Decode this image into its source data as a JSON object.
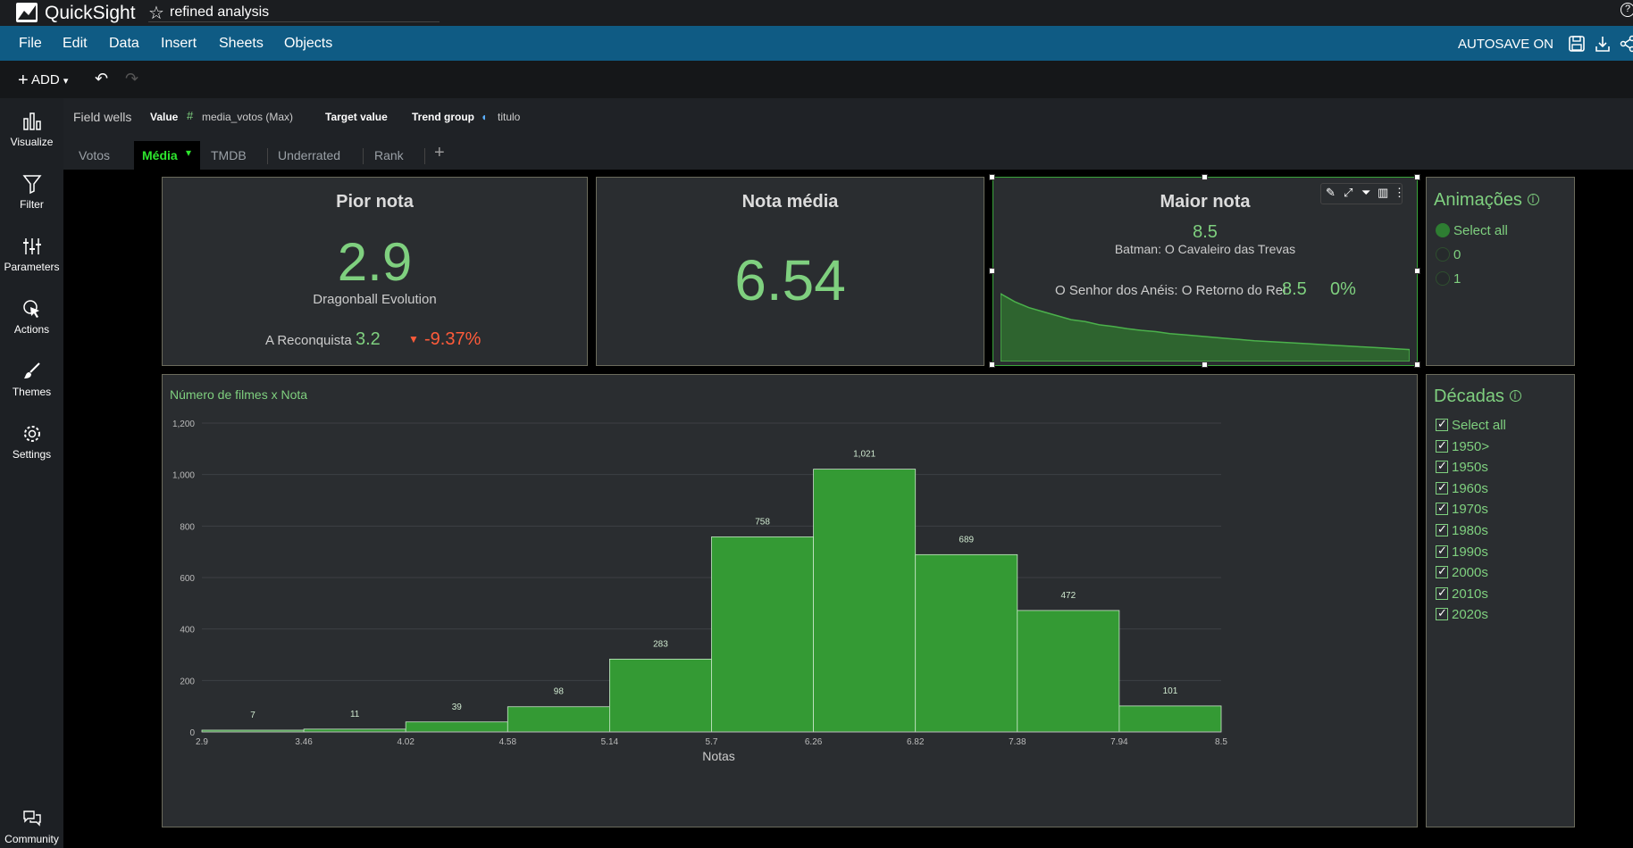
{
  "app": {
    "brand": "QuickSight",
    "analysis_title": "refined analysis"
  },
  "menu": {
    "items": [
      "File",
      "Edit",
      "Data",
      "Insert",
      "Sheets",
      "Objects"
    ],
    "autosave": "AUTOSAVE ON"
  },
  "toolbar": {
    "add_label": "ADD"
  },
  "rail": {
    "items": [
      "Visualize",
      "Filter",
      "Parameters",
      "Actions",
      "Themes",
      "Settings"
    ],
    "community": "Community"
  },
  "field_wells": {
    "title": "Field wells",
    "value_label": "Value",
    "value_field": "media_votos (Max)",
    "target_label": "Target value",
    "trend_label": "Trend group",
    "trend_field": "titulo"
  },
  "tabs": {
    "items": [
      "Votos",
      "Média",
      "TMDB",
      "Underrated",
      "Rank"
    ],
    "active": "Média",
    "add": "+"
  },
  "kpi_pior": {
    "title": "Pior nota",
    "value": "2.9",
    "subtitle": "Dragonball Evolution",
    "compare_label": "A Reconquista",
    "compare_value": "3.2",
    "delta": "-9.37%"
  },
  "kpi_media": {
    "title": "Nota média",
    "value": "6.54"
  },
  "kpi_maior": {
    "title": "Maior nota",
    "value": "8.5",
    "subtitle": "Batman: O Cavaleiro das Trevas",
    "compare_label": "O Senhor dos Anéis: O Retorno do Rei",
    "compare_value": "8.5",
    "delta": "0%"
  },
  "animacoes": {
    "title": "Animações",
    "options": [
      "Select all",
      "0",
      "1"
    ],
    "selected": "Select all"
  },
  "decadas": {
    "title": "Décadas",
    "options": [
      "Select all",
      "1950>",
      "1950s",
      "1960s",
      "1970s",
      "1980s",
      "1990s",
      "2000s",
      "2010s",
      "2020s"
    ]
  },
  "colors": {
    "accent": "#7fd07f",
    "bar": "#349a34",
    "negative": "#ff5b3a",
    "menubar": "#0f5b84"
  },
  "chart_data": {
    "type": "bar",
    "title": "Número de filmes x Nota",
    "xlabel": "Notas",
    "ylabel": "",
    "bin_edges": [
      "2.9",
      "3.46",
      "4.02",
      "4.58",
      "5.14",
      "5.7",
      "6.26",
      "6.82",
      "7.38",
      "7.94",
      "8.5"
    ],
    "values": [
      7,
      11,
      39,
      98,
      283,
      758,
      1021,
      689,
      472,
      101
    ],
    "value_labels": [
      "7",
      "11",
      "39",
      "98",
      "283",
      "758",
      "1,021",
      "689",
      "472",
      "101"
    ],
    "yticks": [
      "0",
      "200",
      "400",
      "600",
      "800",
      "1,000",
      "1,200"
    ],
    "ytick_values": [
      0,
      200,
      400,
      600,
      800,
      1000,
      1200
    ],
    "ylim": [
      0,
      1200
    ],
    "grid": true
  },
  "sparkline": {
    "values": [
      8.5,
      8.3,
      8.15,
      8.05,
      7.95,
      7.85,
      7.8,
      7.72,
      7.68,
      7.62,
      7.58,
      7.55,
      7.5,
      7.47,
      7.44,
      7.41,
      7.38,
      7.35,
      7.32,
      7.3,
      7.28,
      7.26,
      7.24,
      7.22,
      7.2,
      7.18,
      7.16,
      7.14,
      7.12,
      7.1
    ]
  }
}
